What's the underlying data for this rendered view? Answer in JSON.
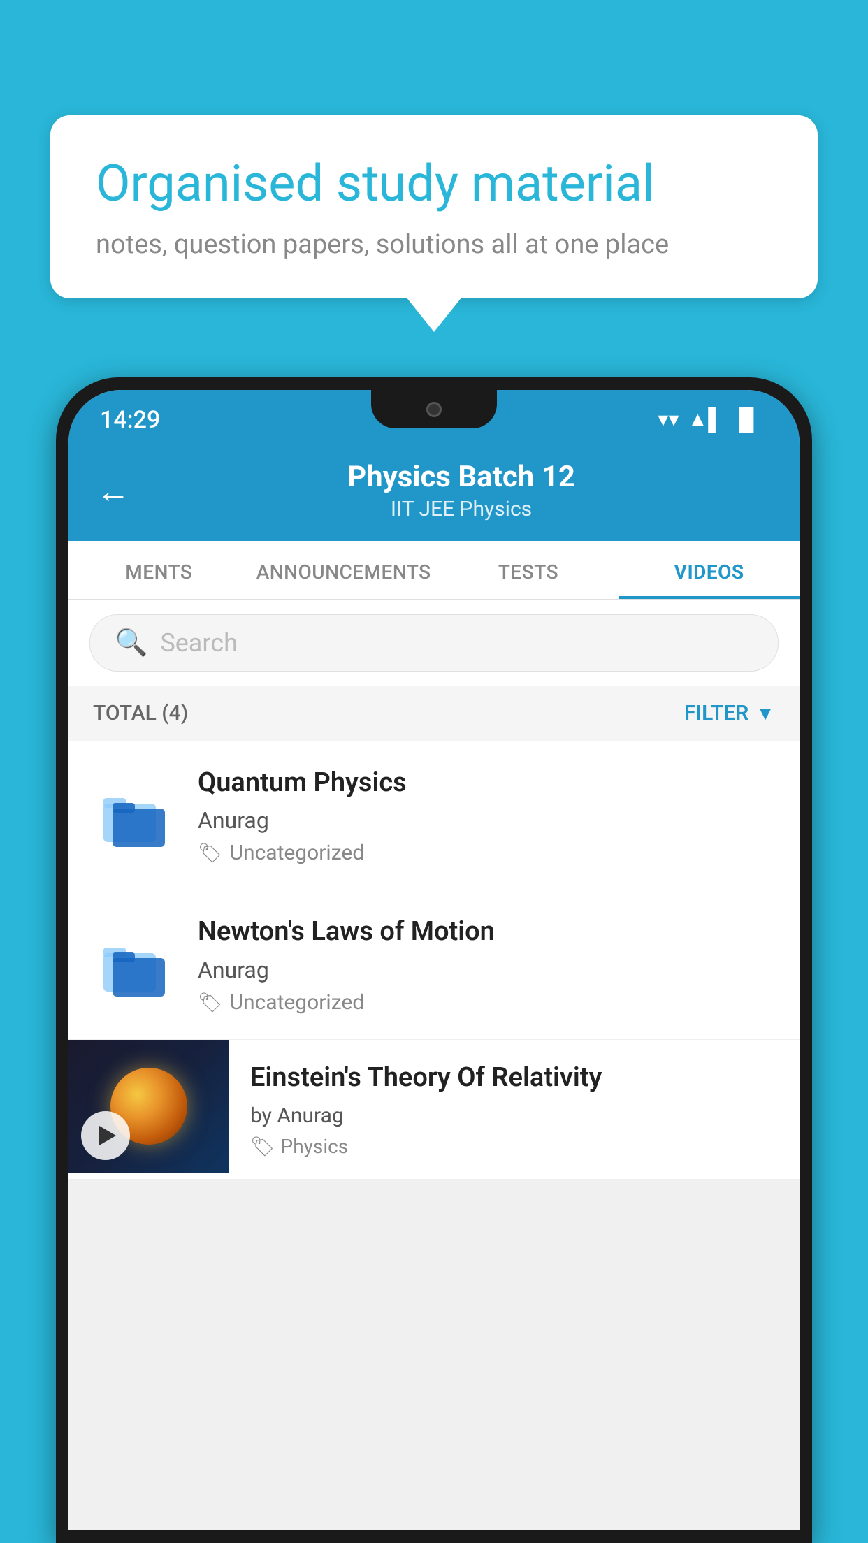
{
  "background_color": "#29B6D8",
  "speech_bubble": {
    "title": "Organised study material",
    "subtitle": "notes, question papers, solutions all at one place"
  },
  "phone": {
    "status_bar": {
      "time": "14:29",
      "wifi": "▼",
      "signal": "▲",
      "battery": "▐"
    },
    "header": {
      "back_label": "←",
      "title": "Physics Batch 12",
      "subtitle": "IIT JEE   Physics"
    },
    "tabs": [
      {
        "label": "MENTS",
        "active": false
      },
      {
        "label": "ANNOUNCEMENTS",
        "active": false
      },
      {
        "label": "TESTS",
        "active": false
      },
      {
        "label": "VIDEOS",
        "active": true
      }
    ],
    "search": {
      "placeholder": "Search"
    },
    "filter_bar": {
      "total_label": "TOTAL (4)",
      "filter_label": "FILTER"
    },
    "videos": [
      {
        "title": "Quantum Physics",
        "author": "Anurag",
        "tag": "Uncategorized",
        "type": "folder"
      },
      {
        "title": "Newton's Laws of Motion",
        "author": "Anurag",
        "tag": "Uncategorized",
        "type": "folder"
      },
      {
        "title": "Einstein's Theory Of Relativity",
        "author": "by Anurag",
        "tag": "Physics",
        "type": "video"
      }
    ]
  }
}
